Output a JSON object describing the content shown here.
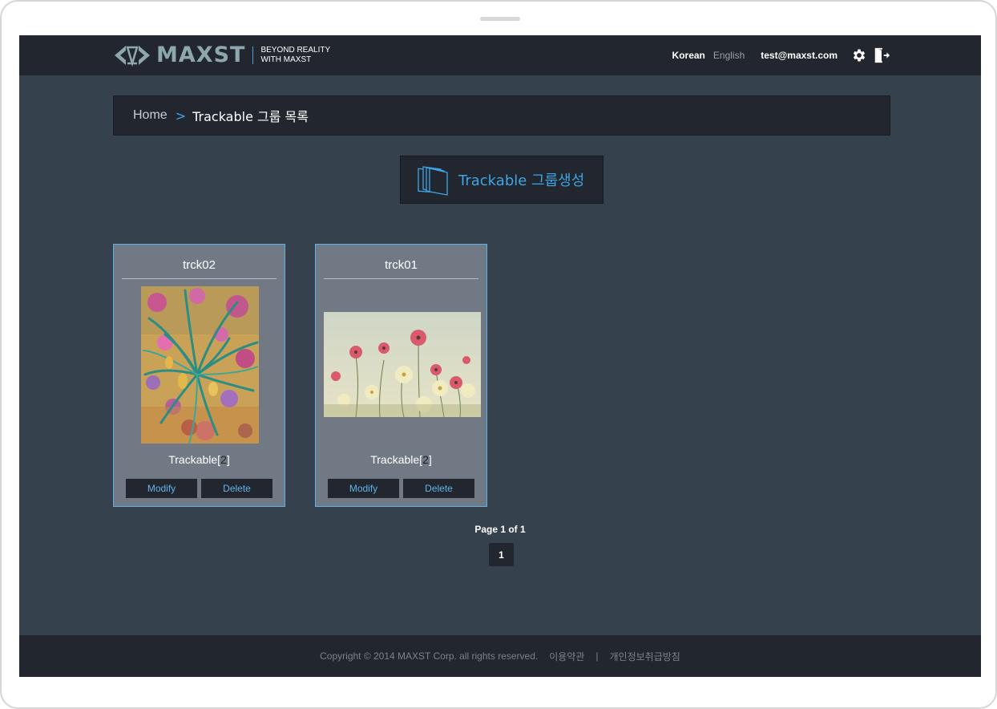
{
  "header": {
    "brand": "MAXST",
    "tagline_line1": "BEYOND REALITY",
    "tagline_line2": "WITH MAXST",
    "lang_korean": "Korean",
    "lang_english": "English",
    "user_email": "test@maxst.com",
    "settings_icon": "gear-icon",
    "logout_icon": "logout-door-icon"
  },
  "breadcrumb": {
    "home": "Home",
    "separator": ">",
    "current": "Trackable 그룹 목록"
  },
  "create_button": {
    "label": "Trackable 그룹생성",
    "icon": "stacked-pages-icon"
  },
  "groups": [
    {
      "title": "trck02",
      "count_prefix": "Trackable[",
      "count": "2",
      "count_suffix": "]",
      "modify_label": "Modify",
      "delete_label": "Delete"
    },
    {
      "title": "trck01",
      "count_prefix": "Trackable[",
      "count": "2",
      "count_suffix": "]",
      "modify_label": "Modify",
      "delete_label": "Delete"
    }
  ],
  "pagination": {
    "info": "Page 1 of 1",
    "current_page": "1"
  },
  "footer": {
    "copyright": "Copyright © 2014 MAXST Corp. all rights reserved.",
    "terms_link": "이용약관",
    "separator": "|",
    "privacy_link": "개인정보취급방침"
  },
  "colors": {
    "accent": "#3fa6e6",
    "header_bg": "#22262e",
    "page_bg": "#36414e",
    "card_bg": "#717a84"
  }
}
